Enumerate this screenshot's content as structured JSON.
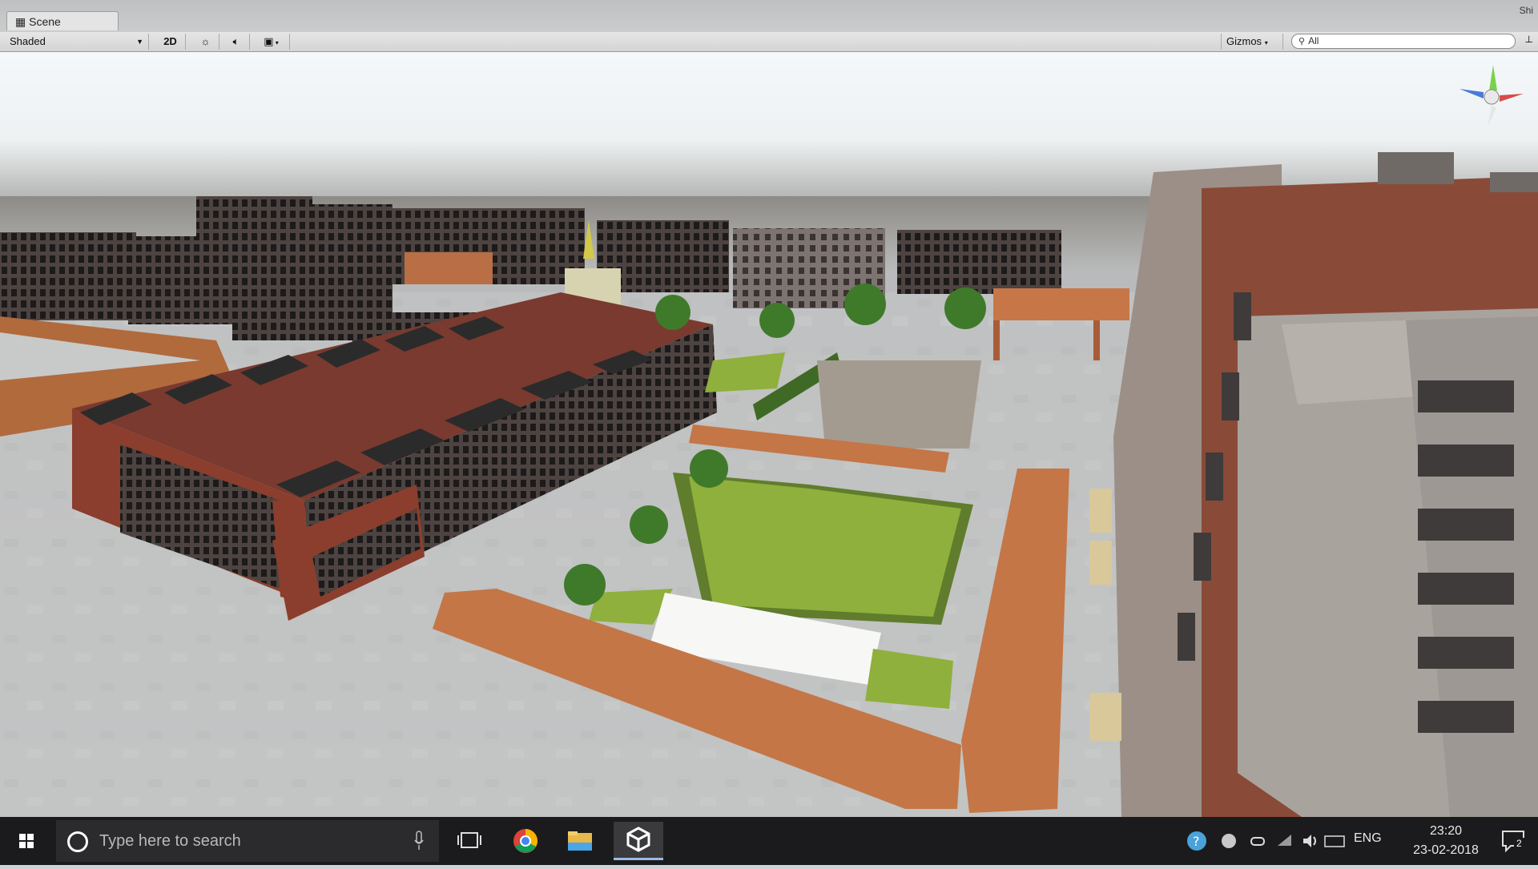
{
  "window": {
    "tab_title": "Scene",
    "corner_label": "Shi"
  },
  "toolbar": {
    "shading_mode": "Shaded",
    "mode_2d": "2D",
    "gizmos_label": "Gizmos",
    "search_placeholder": "All"
  },
  "viewport": {
    "sky_top": "#f2f6f8",
    "ground": "#b6b8ba",
    "roof_color": "#7a3a2f",
    "wall_color": "#8b3e2d",
    "walkway_color": "#c47647",
    "lawn_color": "#8fb03c",
    "pavement_color": "#c5c6c6"
  },
  "taskbar": {
    "search_placeholder": "Type here to search",
    "apps": [
      "task-view",
      "chrome",
      "file-explorer",
      "unity"
    ],
    "language": "ENG",
    "time": "23:20",
    "date": "23-02-2018",
    "notification_count": "2"
  }
}
